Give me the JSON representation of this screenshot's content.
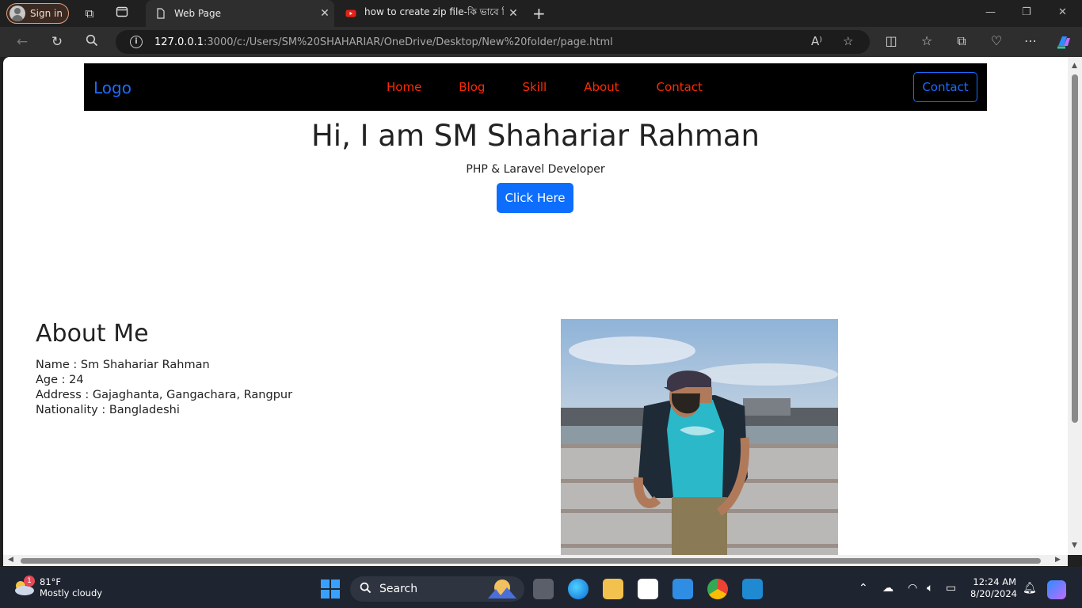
{
  "browser": {
    "sign_in": "Sign in",
    "tabs": [
      {
        "title": "Web Page",
        "active": true
      },
      {
        "title": "how to create zip file-কি ভাবে জি",
        "active": false
      }
    ],
    "url_host": "127.0.0.1",
    "url_path": ":3000/c:/Users/SM%20SHAHARIAR/OneDrive/Desktop/New%20folder/page.html"
  },
  "page": {
    "navbar": {
      "logo": "Logo",
      "menu": [
        "Home",
        "Blog",
        "Skill",
        "About",
        "Contact"
      ],
      "button": "Contact"
    },
    "hero": {
      "title": "Hi, I am SM Shahariar Rahman",
      "subtitle": "PHP & Laravel Developer",
      "button": "Click Here"
    },
    "about": {
      "heading": "About Me",
      "name": "Name : Sm Shahariar Rahman",
      "age": "Age : 24",
      "address": "Address : Gajaghanta, Gangachara, Rangpur",
      "nationality": "Nationality : Bangladeshi"
    },
    "colors": {
      "nav_bg": "#000000",
      "menu_link": "#ff2a00",
      "primary": "#0d6efd"
    }
  },
  "taskbar": {
    "weather_temp": "81°F",
    "weather_desc": "Mostly cloudy",
    "weather_badge": "1",
    "search_label": "Search",
    "time": "12:24 AM",
    "date": "8/20/2024"
  }
}
